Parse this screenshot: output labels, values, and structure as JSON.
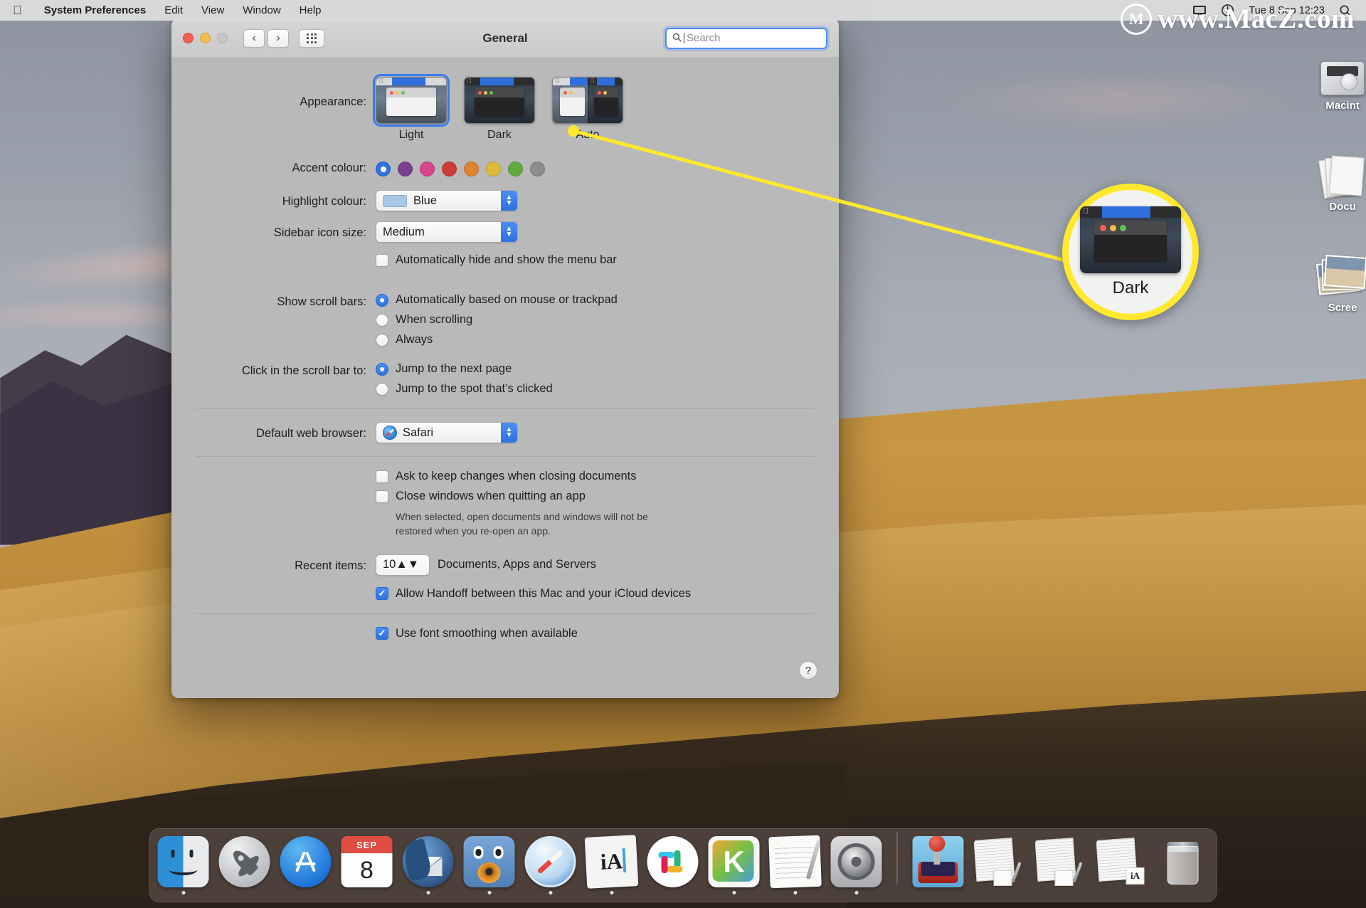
{
  "menubar": {
    "apple_icon": "apple-icon",
    "app_name": "System Preferences",
    "items": [
      "Edit",
      "View",
      "Window",
      "Help"
    ],
    "right": {
      "display_icon": "display-icon",
      "timemachine_icon": "time-machine-icon",
      "clock": "Tue 8 Sep  12:23",
      "search_icon": "spotlight-search-icon"
    }
  },
  "watermark": {
    "mark": "M",
    "text": "www.MacZ.com"
  },
  "desktop_icons": [
    {
      "label": "Macint",
      "icon": "hard-disk-icon"
    },
    {
      "label": "Docu",
      "icon": "documents-stack-icon"
    },
    {
      "label": "Scree",
      "icon": "screenshots-stack-icon"
    }
  ],
  "window": {
    "title": "General",
    "traffic": {
      "close": "close-button",
      "minimize": "minimize-button",
      "zoom": "zoom-button"
    },
    "nav": {
      "back": "‹",
      "forward": "›",
      "grid": "show-all-grid-icon"
    },
    "search": {
      "placeholder": "Search",
      "value": ""
    },
    "appearance": {
      "label": "Appearance:",
      "options": [
        {
          "id": "light",
          "label": "Light",
          "selected": true
        },
        {
          "id": "dark",
          "label": "Dark",
          "selected": false
        },
        {
          "id": "auto",
          "label": "Auto",
          "selected": false
        }
      ]
    },
    "accent": {
      "label": "Accent colour:",
      "colors": [
        "#2f72e0",
        "#7b3f8f",
        "#d8468d",
        "#cc3b38",
        "#e08231",
        "#e0bb36",
        "#64a93e",
        "#8c8c8e"
      ],
      "selected_index": 0
    },
    "highlight": {
      "label": "Highlight colour:",
      "value": "Blue",
      "swatch": "#a9c8e8"
    },
    "sidebar_icon_size": {
      "label": "Sidebar icon size:",
      "value": "Medium"
    },
    "autohide_menubar": {
      "label": "Automatically hide and show the menu bar",
      "checked": false
    },
    "scroll_bars": {
      "label": "Show scroll bars:",
      "options": [
        {
          "label": "Automatically based on mouse or trackpad",
          "selected": true
        },
        {
          "label": "When scrolling",
          "selected": false
        },
        {
          "label": "Always",
          "selected": false
        }
      ]
    },
    "click_scroll": {
      "label": "Click in the scroll bar to:",
      "options": [
        {
          "label": "Jump to the next page",
          "selected": true
        },
        {
          "label": "Jump to the spot that’s clicked",
          "selected": false
        }
      ]
    },
    "default_browser": {
      "label": "Default web browser:",
      "value": "Safari",
      "icon": "safari-icon"
    },
    "ask_keep_changes": {
      "label": "Ask to keep changes when closing documents",
      "checked": false
    },
    "close_windows": {
      "label": "Close windows when quitting an app",
      "checked": false
    },
    "close_windows_hint": "When selected, open documents and windows will not be restored when you re-open an app.",
    "recent_items": {
      "label": "Recent items:",
      "value": "10",
      "suffix": "Documents, Apps and Servers"
    },
    "handoff": {
      "label": "Allow Handoff between this Mac and your iCloud devices",
      "checked": true
    },
    "font_smoothing": {
      "label": "Use font smoothing when available",
      "checked": true
    },
    "help_button": "?"
  },
  "callout": {
    "magnified_label": "Dark",
    "line_color": "#ffe92e"
  },
  "dock": {
    "items": [
      {
        "name": "Finder",
        "icon": "finder-icon",
        "running": true
      },
      {
        "name": "Launchpad",
        "icon": "launchpad-icon",
        "running": false
      },
      {
        "name": "App Store",
        "icon": "app-store-icon",
        "running": false
      },
      {
        "name": "Calendar",
        "icon": "calendar-icon",
        "running": false,
        "month": "SEP",
        "day": "8"
      },
      {
        "name": "Thunderbird",
        "icon": "thunderbird-icon",
        "running": true
      },
      {
        "name": "Transmission",
        "icon": "transmission-icon",
        "running": true
      },
      {
        "name": "Safari",
        "icon": "safari-icon",
        "running": true
      },
      {
        "name": "iA Writer",
        "icon": "ia-writer-icon",
        "running": true,
        "glyph": "iA"
      },
      {
        "name": "Slack",
        "icon": "slack-icon",
        "running": false
      },
      {
        "name": "Kodi",
        "icon": "kodi-icon",
        "running": true,
        "glyph": "K"
      },
      {
        "name": "TextEdit",
        "icon": "textedit-icon",
        "running": true
      },
      {
        "name": "System Preferences",
        "icon": "system-preferences-icon",
        "running": true
      }
    ],
    "stacks": [
      {
        "name": "Games folder",
        "icon": "joystick-folder-icon"
      },
      {
        "name": "Document stack 1",
        "icon": "document-stack-icon"
      },
      {
        "name": "Document stack 2",
        "icon": "document-stack-icon"
      },
      {
        "name": "iA document stack",
        "icon": "ia-document-stack-icon",
        "glyph": "iA"
      },
      {
        "name": "Trash",
        "icon": "trash-icon"
      }
    ]
  }
}
